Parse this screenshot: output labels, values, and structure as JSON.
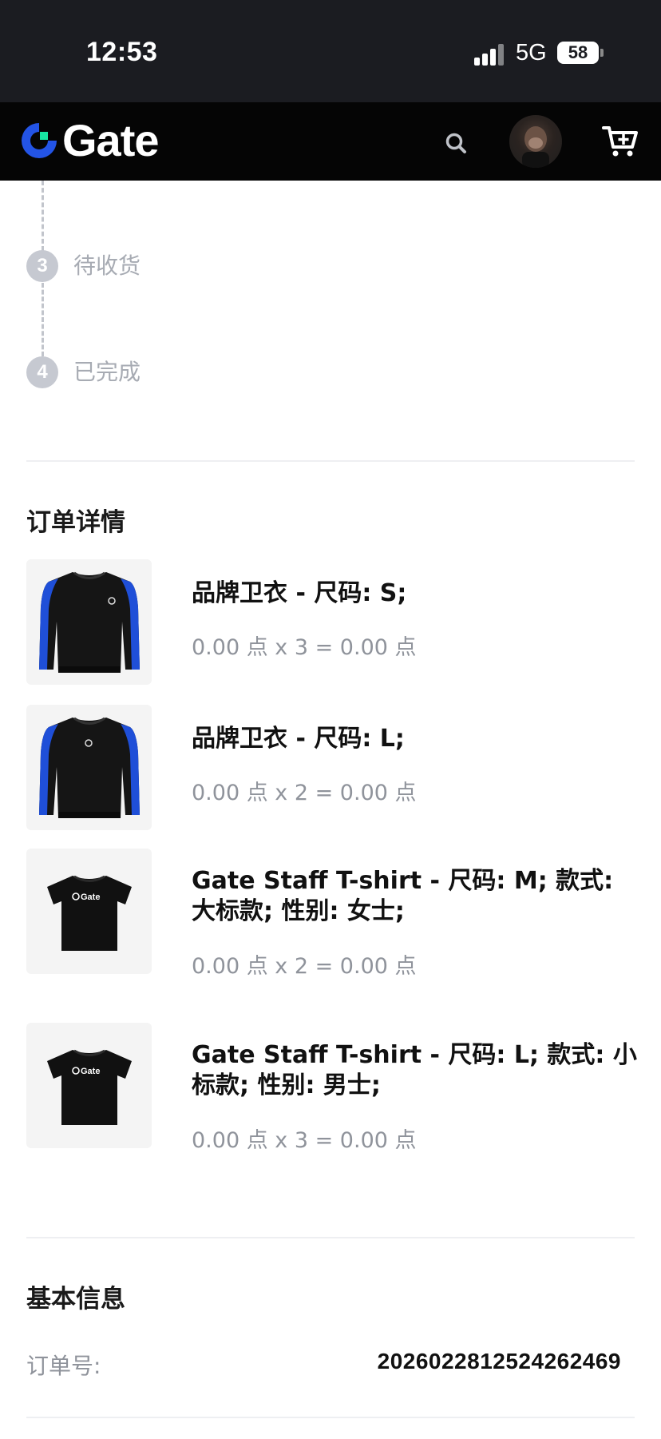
{
  "status_bar": {
    "time": "12:53",
    "network": "5G",
    "battery": "58"
  },
  "header": {
    "logo_text": "Gate"
  },
  "timeline": {
    "steps": [
      {
        "number": "3",
        "label": "待收货"
      },
      {
        "number": "4",
        "label": "已完成"
      }
    ]
  },
  "order_details": {
    "title": "订单详情",
    "items": [
      {
        "name": "品牌卫衣 - 尺码: S;",
        "price": "0.00 点 x 3 = 0.00 点",
        "image": "sweatshirt"
      },
      {
        "name": "品牌卫衣 - 尺码: L;",
        "price": "0.00 点 x 2 = 0.00 点",
        "image": "sweatshirt"
      },
      {
        "name": "Gate Staff T-shirt - 尺码: M; 款式: 大标款; 性别: 女士;",
        "price": "0.00 点 x 2 = 0.00 点",
        "image": "tshirt"
      },
      {
        "name": "Gate Staff T-shirt - 尺码: L; 款式: 小标款; 性别: 男士;",
        "price": "0.00 点 x 3 = 0.00 点",
        "image": "tshirt"
      }
    ]
  },
  "basic_info": {
    "title": "基本信息",
    "order_number_label": "订单号:",
    "order_number_value": "2026022812524262469"
  },
  "colors": {
    "brand_blue": "#2354e6",
    "brand_green": "#17e6a1",
    "header_bg": "#050505"
  }
}
